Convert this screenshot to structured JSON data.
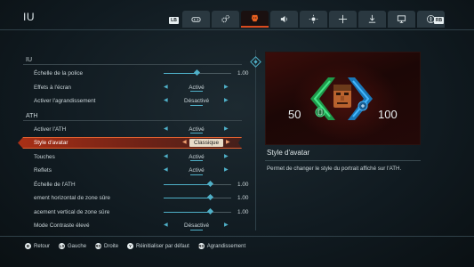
{
  "header": {
    "title": "IU",
    "bumper_left": "LB",
    "bumper_right": "RB",
    "tabs": [
      {
        "icon": "gamepad-icon",
        "active": false
      },
      {
        "icon": "gears-icon",
        "active": false
      },
      {
        "icon": "doomguy-icon",
        "active": true
      },
      {
        "icon": "speaker-icon",
        "active": false
      },
      {
        "icon": "brightness-icon",
        "active": false
      },
      {
        "icon": "crosshair-icon",
        "active": false
      },
      {
        "icon": "download-icon",
        "active": false
      },
      {
        "icon": "monitor-icon",
        "active": false
      },
      {
        "icon": "accessibility-icon",
        "active": false
      }
    ]
  },
  "sections": {
    "iu": "IU",
    "ath": "ATH"
  },
  "rows": {
    "font_scale": {
      "label": "Échelle de la police",
      "value": "1.00",
      "level": 0.5
    },
    "screen_effects": {
      "label": "Effets à l'écran",
      "value": "Activé"
    },
    "zoom": {
      "label": "Activer l'agrandissement",
      "value": "Désactivé"
    },
    "enable_hud": {
      "label": "Activer l'ATH",
      "value": "Activé"
    },
    "avatar_style": {
      "label": "Style d'avatar",
      "value": "Classique"
    },
    "keys": {
      "label": "Touches",
      "value": "Activé"
    },
    "reflections": {
      "label": "Reflets",
      "value": "Activé"
    },
    "hud_scale": {
      "label": "Échelle de l'ATH",
      "value": "1.00",
      "level": 0.7
    },
    "safe_h": {
      "label": "ement horizontal de zone sûre",
      "value": "1.00",
      "level": 0.7
    },
    "safe_v": {
      "label": "acement vertical de zone sûre",
      "value": "1.00",
      "level": 0.7
    },
    "high_contrast": {
      "label": "Mode Contraste élevé",
      "value": "Désactivé"
    }
  },
  "preview": {
    "health": "50",
    "armor": "100"
  },
  "description": {
    "title": "Style d'avatar",
    "text": "Permet de changer le style du portrait affiché sur l'ATH."
  },
  "footer": [
    {
      "button": "B",
      "label": "Retour"
    },
    {
      "button": "LS",
      "label": "Gauche"
    },
    {
      "button": "RS",
      "label": "Droite"
    },
    {
      "button": "Y",
      "label": "Réinitialiser par défaut"
    },
    {
      "button": "RS",
      "label": "Agrandissement"
    }
  ],
  "colors": {
    "accent": "#4fb0c8",
    "selection": "#c43414",
    "active_tab": "#d94a1e",
    "health_green": "#2fd070",
    "armor_blue": "#2a9fe0"
  }
}
